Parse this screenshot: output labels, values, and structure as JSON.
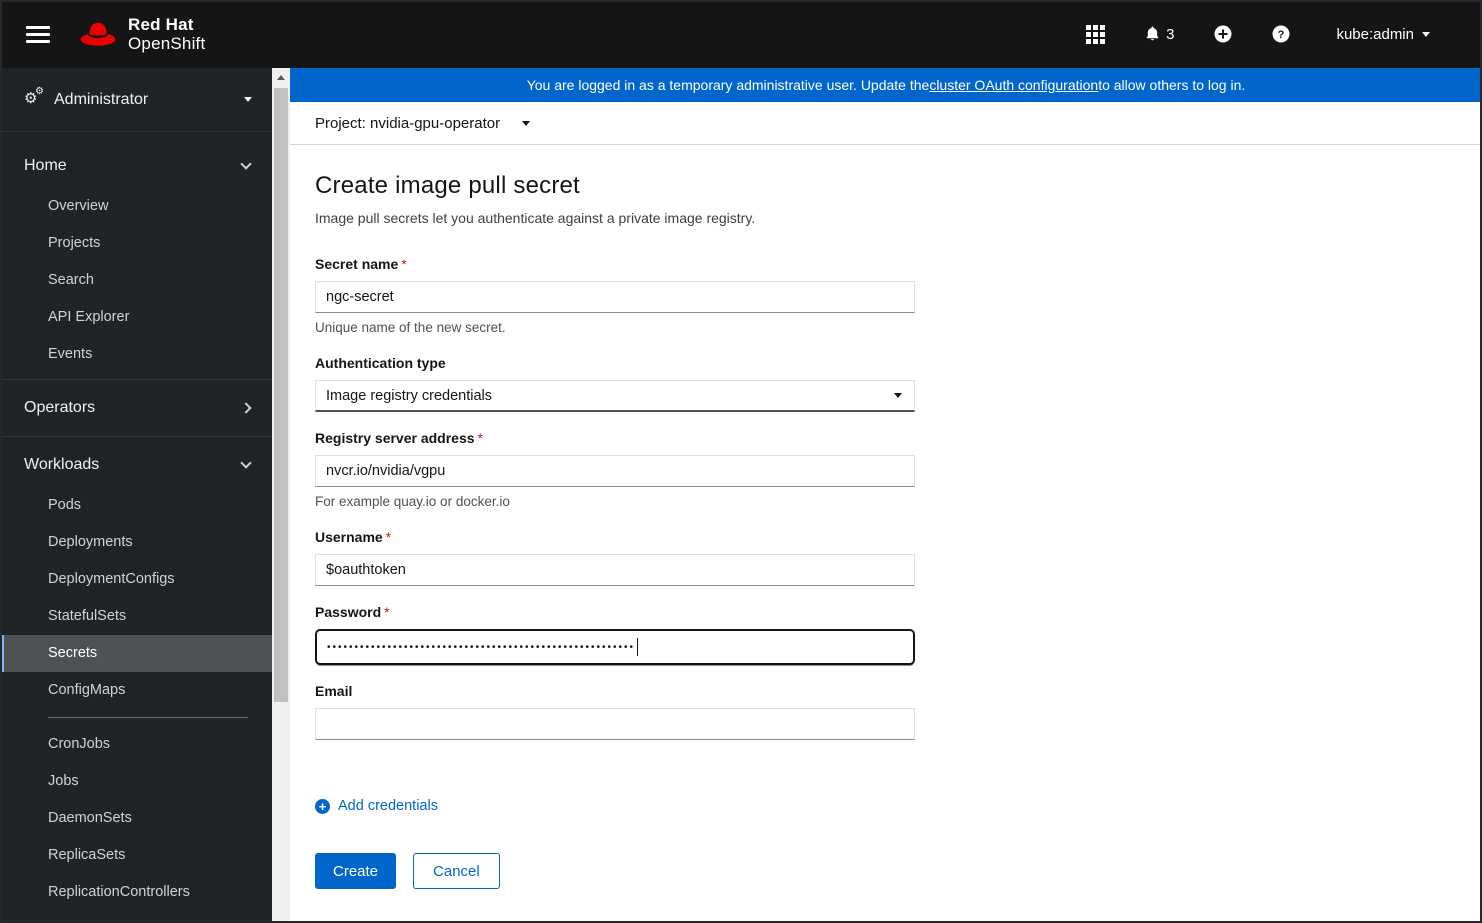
{
  "header": {
    "brand_line1": "Red Hat",
    "brand_line2": "OpenShift",
    "notifications_count": "3",
    "username": "kube:admin"
  },
  "banner": {
    "text_before": "You are logged in as a temporary administrative user. Update the ",
    "link_text": "cluster OAuth configuration",
    "text_after": " to allow others to log in."
  },
  "project_bar": {
    "label": "Project: nvidia-gpu-operator"
  },
  "sidebar": {
    "perspective": "Administrator",
    "groups": [
      {
        "label": "Home",
        "state": "expanded",
        "items": [
          "Overview",
          "Projects",
          "Search",
          "API Explorer",
          "Events"
        ]
      },
      {
        "label": "Operators",
        "state": "collapsed",
        "items": []
      },
      {
        "label": "Workloads",
        "state": "expanded",
        "active_item": "Secrets",
        "items": [
          "Pods",
          "Deployments",
          "DeploymentConfigs",
          "StatefulSets",
          "Secrets",
          "ConfigMaps",
          "CronJobs",
          "Jobs",
          "DaemonSets",
          "ReplicaSets",
          "ReplicationControllers"
        ]
      }
    ]
  },
  "form": {
    "title": "Create image pull secret",
    "subtitle": "Image pull secrets let you authenticate against a private image registry.",
    "required_indicator": "*",
    "fields": {
      "secret_name": {
        "label": "Secret name",
        "required": true,
        "value": "ngc-secret",
        "help": "Unique name of the new secret."
      },
      "auth_type": {
        "label": "Authentication type",
        "required": false,
        "value": "Image registry credentials"
      },
      "registry": {
        "label": "Registry server address",
        "required": true,
        "value": "nvcr.io/nvidia/vgpu",
        "help": "For example quay.io or docker.io"
      },
      "username": {
        "label": "Username",
        "required": true,
        "value": "$oauthtoken"
      },
      "password": {
        "label": "Password",
        "required": true,
        "masked_value": "••••••••••••••••••••••••••••••••••••••••••••••••••••••••"
      },
      "email": {
        "label": "Email",
        "required": false,
        "value": ""
      }
    },
    "add_credentials_label": "Add credentials",
    "create_label": "Create",
    "cancel_label": "Cancel"
  },
  "icons": {
    "cog_glyph": "⚙"
  },
  "colors": {
    "accent": "#0066cc",
    "masthead_bg": "#151515",
    "sidebar_bg": "#212427",
    "active_nav_bg": "#4f5255",
    "active_nav_border": "#73bcf7",
    "banner_bg": "#0066cc",
    "required": "#c9190b"
  }
}
